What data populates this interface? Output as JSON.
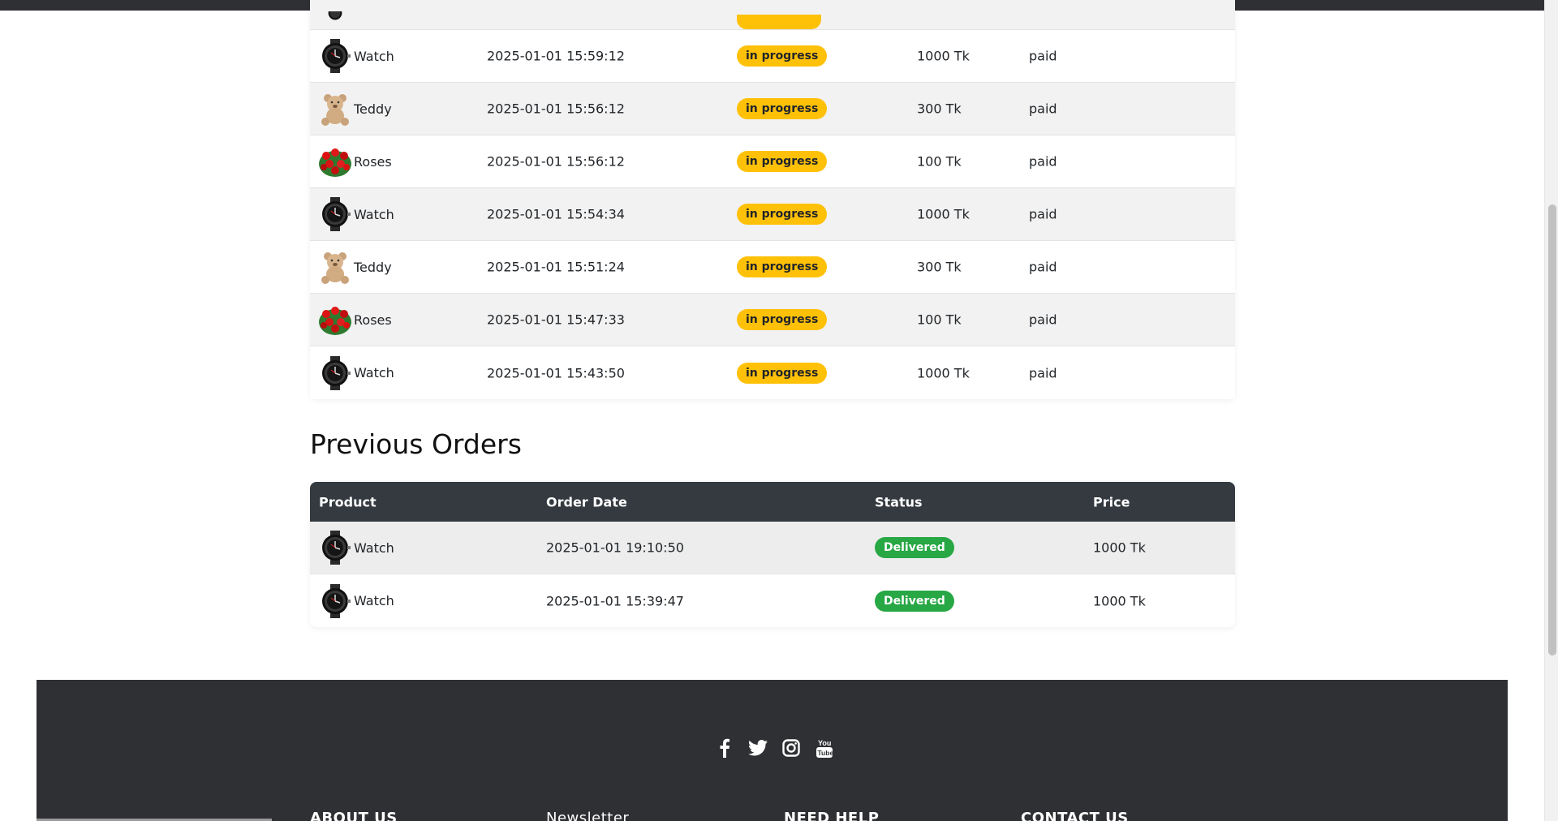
{
  "active_orders": [
    {
      "product": "Watch",
      "icon": "watch-icon",
      "date": "2025-01-01 15:59:12",
      "status": "in progress",
      "price": "1000 Tk",
      "payment": "paid"
    },
    {
      "product": "Teddy",
      "icon": "teddy-bear-icon",
      "date": "2025-01-01 15:56:12",
      "status": "in progress",
      "price": "300 Tk",
      "payment": "paid"
    },
    {
      "product": "Roses",
      "icon": "roses-icon",
      "date": "2025-01-01 15:56:12",
      "status": "in progress",
      "price": "100 Tk",
      "payment": "paid"
    },
    {
      "product": "Watch",
      "icon": "watch-icon",
      "date": "2025-01-01 15:54:34",
      "status": "in progress",
      "price": "1000 Tk",
      "payment": "paid"
    },
    {
      "product": "Teddy",
      "icon": "teddy-bear-icon",
      "date": "2025-01-01 15:51:24",
      "status": "in progress",
      "price": "300 Tk",
      "payment": "paid"
    },
    {
      "product": "Roses",
      "icon": "roses-icon",
      "date": "2025-01-01 15:47:33",
      "status": "in progress",
      "price": "100 Tk",
      "payment": "paid"
    },
    {
      "product": "Watch",
      "icon": "watch-icon",
      "date": "2025-01-01 15:43:50",
      "status": "in progress",
      "price": "1000 Tk",
      "payment": "paid"
    }
  ],
  "previous_orders": {
    "title": "Previous Orders",
    "headers": {
      "product": "Product",
      "date": "Order Date",
      "status": "Status",
      "price": "Price"
    },
    "rows": [
      {
        "product": "Watch",
        "icon": "watch-icon",
        "date": "2025-01-01 19:10:50",
        "status": "Delivered",
        "price": "1000 Tk"
      },
      {
        "product": "Watch",
        "icon": "watch-icon",
        "date": "2025-01-01 15:39:47",
        "status": "Delivered",
        "price": "1000 Tk"
      }
    ]
  },
  "footer": {
    "social": [
      "facebook-icon",
      "twitter-icon",
      "instagram-icon",
      "youtube-icon"
    ],
    "columns": [
      "ABOUT US",
      "Newsletter",
      "NEED HELP",
      "CONTACT US"
    ]
  },
  "colors": {
    "in_progress": "#ffc107",
    "delivered": "#28a745",
    "table_header": "#343a40",
    "footer_bg": "#2f3033"
  }
}
